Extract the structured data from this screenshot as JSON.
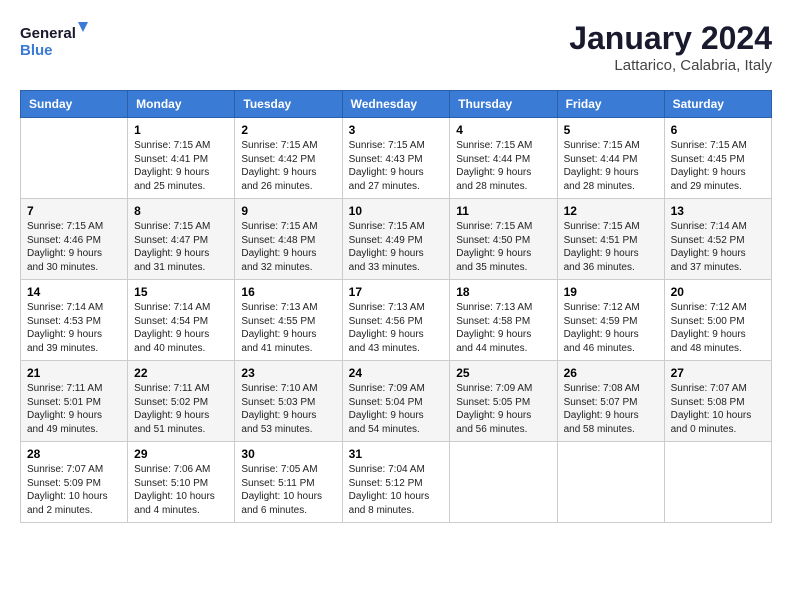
{
  "header": {
    "logo_general": "General",
    "logo_blue": "Blue",
    "month_year": "January 2024",
    "location": "Lattarico, Calabria, Italy"
  },
  "days_of_week": [
    "Sunday",
    "Monday",
    "Tuesday",
    "Wednesday",
    "Thursday",
    "Friday",
    "Saturday"
  ],
  "weeks": [
    [
      {
        "day": "",
        "content": ""
      },
      {
        "day": "1",
        "content": "Sunrise: 7:15 AM\nSunset: 4:41 PM\nDaylight: 9 hours\nand 25 minutes."
      },
      {
        "day": "2",
        "content": "Sunrise: 7:15 AM\nSunset: 4:42 PM\nDaylight: 9 hours\nand 26 minutes."
      },
      {
        "day": "3",
        "content": "Sunrise: 7:15 AM\nSunset: 4:43 PM\nDaylight: 9 hours\nand 27 minutes."
      },
      {
        "day": "4",
        "content": "Sunrise: 7:15 AM\nSunset: 4:44 PM\nDaylight: 9 hours\nand 28 minutes."
      },
      {
        "day": "5",
        "content": "Sunrise: 7:15 AM\nSunset: 4:44 PM\nDaylight: 9 hours\nand 28 minutes."
      },
      {
        "day": "6",
        "content": "Sunrise: 7:15 AM\nSunset: 4:45 PM\nDaylight: 9 hours\nand 29 minutes."
      }
    ],
    [
      {
        "day": "7",
        "content": "Sunrise: 7:15 AM\nSunset: 4:46 PM\nDaylight: 9 hours\nand 30 minutes."
      },
      {
        "day": "8",
        "content": "Sunrise: 7:15 AM\nSunset: 4:47 PM\nDaylight: 9 hours\nand 31 minutes."
      },
      {
        "day": "9",
        "content": "Sunrise: 7:15 AM\nSunset: 4:48 PM\nDaylight: 9 hours\nand 32 minutes."
      },
      {
        "day": "10",
        "content": "Sunrise: 7:15 AM\nSunset: 4:49 PM\nDaylight: 9 hours\nand 33 minutes."
      },
      {
        "day": "11",
        "content": "Sunrise: 7:15 AM\nSunset: 4:50 PM\nDaylight: 9 hours\nand 35 minutes."
      },
      {
        "day": "12",
        "content": "Sunrise: 7:15 AM\nSunset: 4:51 PM\nDaylight: 9 hours\nand 36 minutes."
      },
      {
        "day": "13",
        "content": "Sunrise: 7:14 AM\nSunset: 4:52 PM\nDaylight: 9 hours\nand 37 minutes."
      }
    ],
    [
      {
        "day": "14",
        "content": "Sunrise: 7:14 AM\nSunset: 4:53 PM\nDaylight: 9 hours\nand 39 minutes."
      },
      {
        "day": "15",
        "content": "Sunrise: 7:14 AM\nSunset: 4:54 PM\nDaylight: 9 hours\nand 40 minutes."
      },
      {
        "day": "16",
        "content": "Sunrise: 7:13 AM\nSunset: 4:55 PM\nDaylight: 9 hours\nand 41 minutes."
      },
      {
        "day": "17",
        "content": "Sunrise: 7:13 AM\nSunset: 4:56 PM\nDaylight: 9 hours\nand 43 minutes."
      },
      {
        "day": "18",
        "content": "Sunrise: 7:13 AM\nSunset: 4:58 PM\nDaylight: 9 hours\nand 44 minutes."
      },
      {
        "day": "19",
        "content": "Sunrise: 7:12 AM\nSunset: 4:59 PM\nDaylight: 9 hours\nand 46 minutes."
      },
      {
        "day": "20",
        "content": "Sunrise: 7:12 AM\nSunset: 5:00 PM\nDaylight: 9 hours\nand 48 minutes."
      }
    ],
    [
      {
        "day": "21",
        "content": "Sunrise: 7:11 AM\nSunset: 5:01 PM\nDaylight: 9 hours\nand 49 minutes."
      },
      {
        "day": "22",
        "content": "Sunrise: 7:11 AM\nSunset: 5:02 PM\nDaylight: 9 hours\nand 51 minutes."
      },
      {
        "day": "23",
        "content": "Sunrise: 7:10 AM\nSunset: 5:03 PM\nDaylight: 9 hours\nand 53 minutes."
      },
      {
        "day": "24",
        "content": "Sunrise: 7:09 AM\nSunset: 5:04 PM\nDaylight: 9 hours\nand 54 minutes."
      },
      {
        "day": "25",
        "content": "Sunrise: 7:09 AM\nSunset: 5:05 PM\nDaylight: 9 hours\nand 56 minutes."
      },
      {
        "day": "26",
        "content": "Sunrise: 7:08 AM\nSunset: 5:07 PM\nDaylight: 9 hours\nand 58 minutes."
      },
      {
        "day": "27",
        "content": "Sunrise: 7:07 AM\nSunset: 5:08 PM\nDaylight: 10 hours\nand 0 minutes."
      }
    ],
    [
      {
        "day": "28",
        "content": "Sunrise: 7:07 AM\nSunset: 5:09 PM\nDaylight: 10 hours\nand 2 minutes."
      },
      {
        "day": "29",
        "content": "Sunrise: 7:06 AM\nSunset: 5:10 PM\nDaylight: 10 hours\nand 4 minutes."
      },
      {
        "day": "30",
        "content": "Sunrise: 7:05 AM\nSunset: 5:11 PM\nDaylight: 10 hours\nand 6 minutes."
      },
      {
        "day": "31",
        "content": "Sunrise: 7:04 AM\nSunset: 5:12 PM\nDaylight: 10 hours\nand 8 minutes."
      },
      {
        "day": "",
        "content": ""
      },
      {
        "day": "",
        "content": ""
      },
      {
        "day": "",
        "content": ""
      }
    ]
  ]
}
